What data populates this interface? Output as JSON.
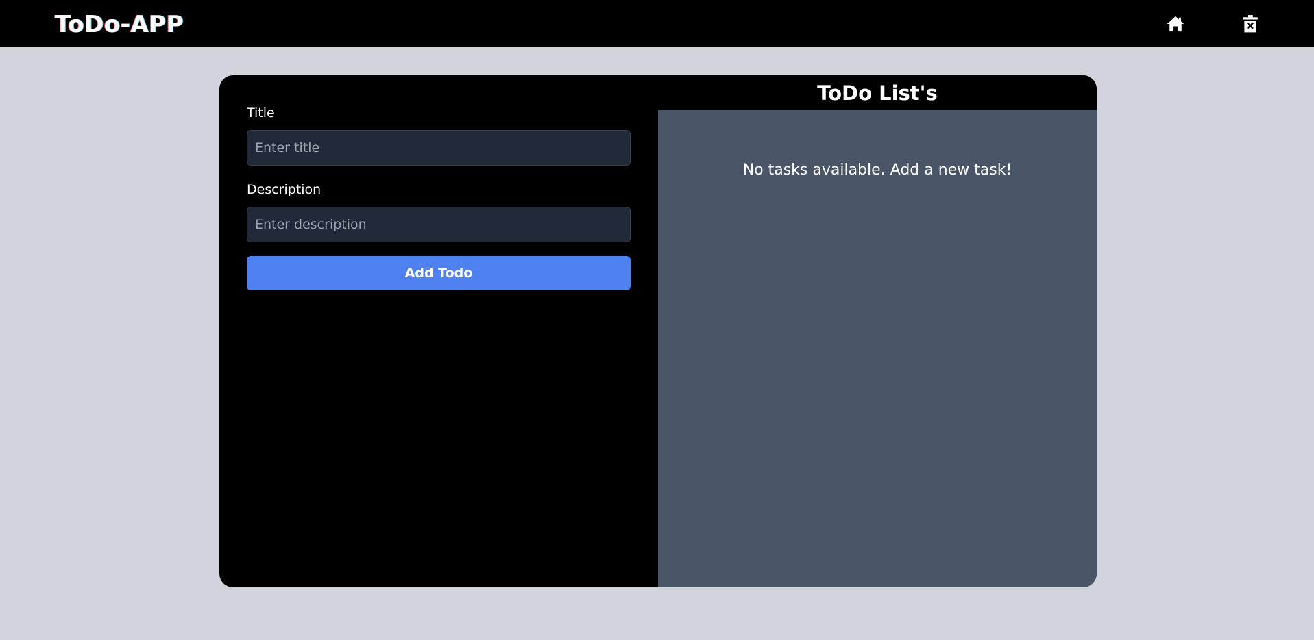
{
  "app": {
    "brand": "ToDo-APP"
  },
  "nav": {
    "home_icon": "home-icon",
    "clear_icon": "trash-x-icon"
  },
  "form": {
    "title_label": "Title",
    "title_placeholder": "Enter title",
    "title_value": "",
    "description_label": "Description",
    "description_placeholder": "Enter description",
    "description_value": "",
    "submit_label": "Add Todo"
  },
  "list": {
    "heading": "ToDo List's",
    "empty_message": "No tasks available. Add a new task!",
    "items": []
  },
  "colors": {
    "page_bg": "#d1d5db",
    "navbar_bg": "#000000",
    "card_bg": "#000000",
    "list_bg": "#4a5568",
    "input_bg": "#1f2937",
    "accent": "#5081f0"
  }
}
